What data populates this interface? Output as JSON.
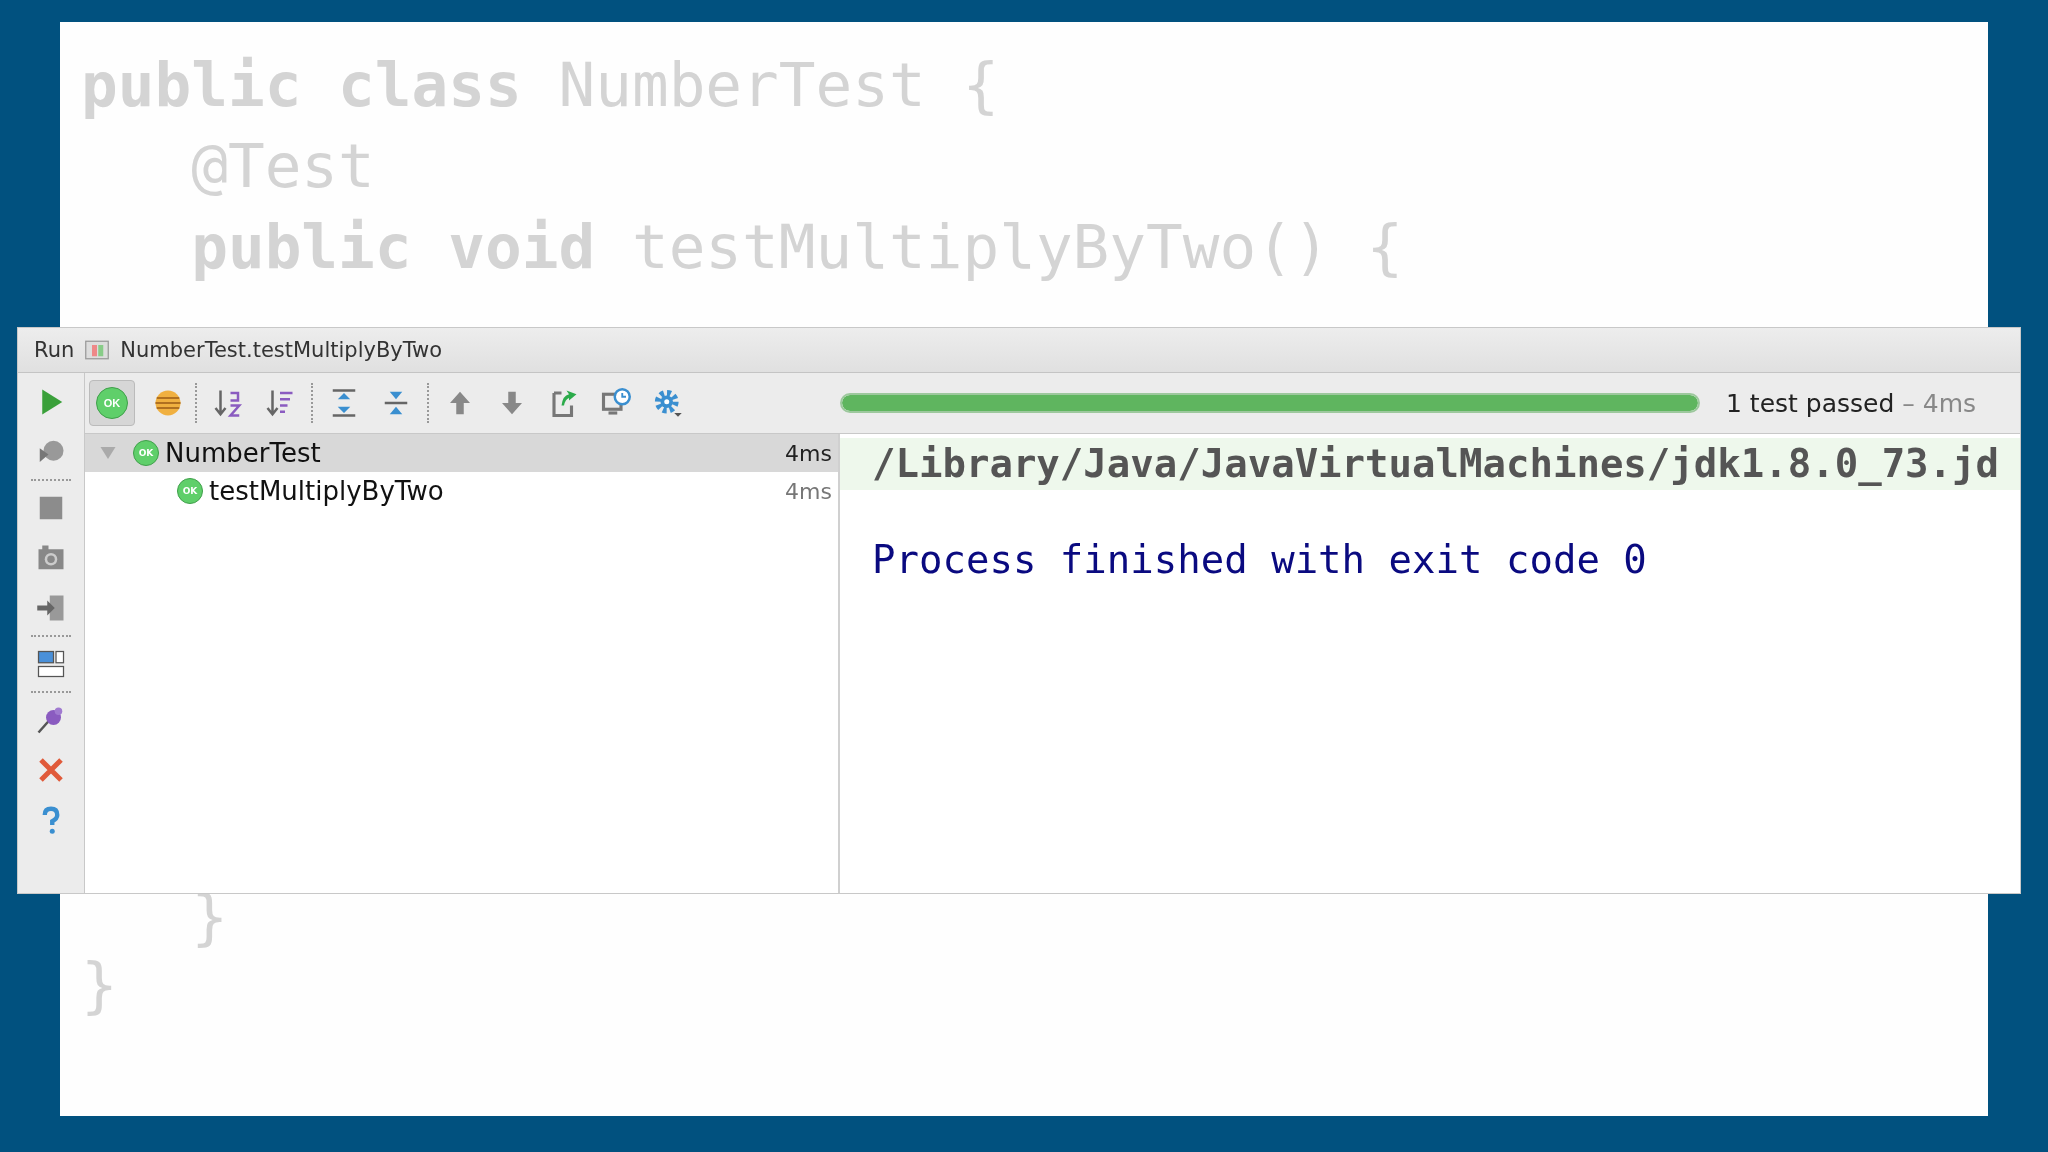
{
  "slide": {
    "code_lines": [
      {
        "text": "**public** **class** NumberTest {"
      },
      {
        "text": "   @Test"
      },
      {
        "text": "   **public** **void** testMultiplyByTwo() {"
      }
    ],
    "closing_lines": [
      {
        "text": "   }"
      },
      {
        "text": "}"
      }
    ]
  },
  "run_panel": {
    "title_label": "Run",
    "tab_title": "NumberTest.testMultiplyByTwo",
    "side_tools": [
      {
        "kind": "run"
      },
      {
        "kind": "rerun-failed"
      },
      {
        "kind": "separator"
      },
      {
        "kind": "stop"
      },
      {
        "kind": "camera"
      },
      {
        "kind": "import"
      },
      {
        "kind": "separator"
      },
      {
        "kind": "layout"
      },
      {
        "kind": "separator"
      },
      {
        "kind": "pin"
      },
      {
        "kind": "close"
      },
      {
        "kind": "help"
      }
    ],
    "filters": [
      {
        "kind": "passed",
        "badge": "OK",
        "selected": true
      },
      {
        "kind": "ignored",
        "selected": false
      }
    ],
    "tools": [
      {
        "kind": "separator"
      },
      {
        "kind": "sort-alpha"
      },
      {
        "kind": "sort-duration"
      },
      {
        "kind": "separator"
      },
      {
        "kind": "expand-all"
      },
      {
        "kind": "collapse-all"
      },
      {
        "kind": "separator"
      },
      {
        "kind": "up"
      },
      {
        "kind": "down"
      },
      {
        "kind": "export"
      },
      {
        "kind": "history"
      },
      {
        "kind": "settings"
      }
    ],
    "progress": {
      "level": 1
    },
    "status": {
      "text": "1 test passed",
      "duration": "– 4ms"
    },
    "tree": [
      {
        "name": "NumberTest",
        "badge": "OK",
        "time": "4ms",
        "selected": true,
        "expanded": true,
        "children": [
          {
            "name": "testMultiplyByTwo",
            "badge": "OK",
            "time": "4ms",
            "selected": false
          }
        ]
      }
    ],
    "console": [
      {
        "kind": "command",
        "text": "/Library/Java/JavaVirtualMachines/jdk1.8.0_73.jd"
      },
      {
        "kind": "result",
        "text": "Process finished with exit code 0"
      }
    ]
  }
}
